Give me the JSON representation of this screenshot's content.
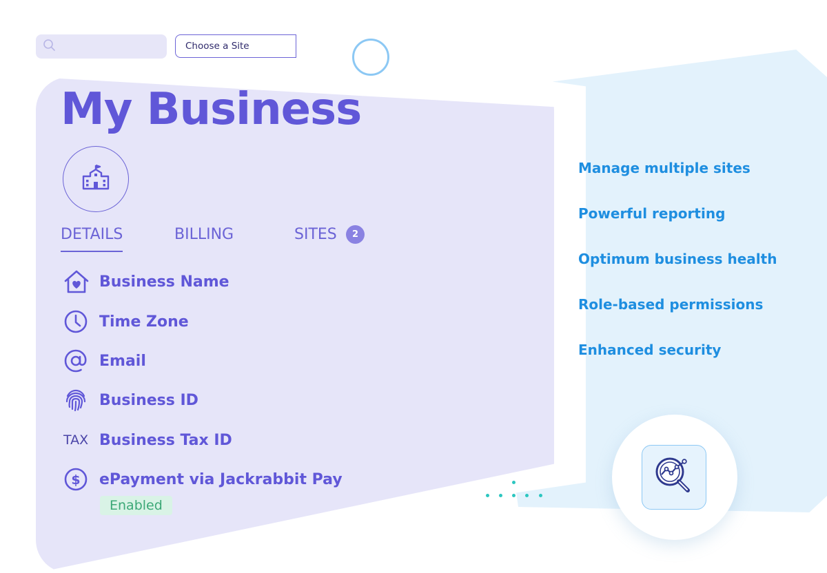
{
  "search": {
    "placeholder": ""
  },
  "site_selector": {
    "label": "Choose a Site"
  },
  "page": {
    "title": "My Business"
  },
  "tabs": [
    {
      "label": "DETAILS",
      "active": true
    },
    {
      "label": "BILLING"
    },
    {
      "label": "SITES",
      "badge": "2"
    }
  ],
  "fields": [
    {
      "icon": "home-heart-icon",
      "label": "Business Name"
    },
    {
      "icon": "clock-icon",
      "label": "Time Zone"
    },
    {
      "icon": "at-sign-icon",
      "label": "Email"
    },
    {
      "icon": "fingerprint-icon",
      "label": "Business ID"
    },
    {
      "icon_text": "TAX",
      "label": "Business Tax ID"
    },
    {
      "icon": "dollar-circle-icon",
      "label": "ePayment via Jackrabbit Pay",
      "status": "Enabled"
    }
  ],
  "features": [
    "Manage multiple sites",
    "Powerful reporting",
    "Optimum business health",
    "Role-based permissions",
    "Enhanced security"
  ],
  "colors": {
    "primary": "#6057D8",
    "feature_text": "#1E8EE0",
    "enabled_bg": "#D9F3E6",
    "enabled_text": "#3CA877"
  }
}
